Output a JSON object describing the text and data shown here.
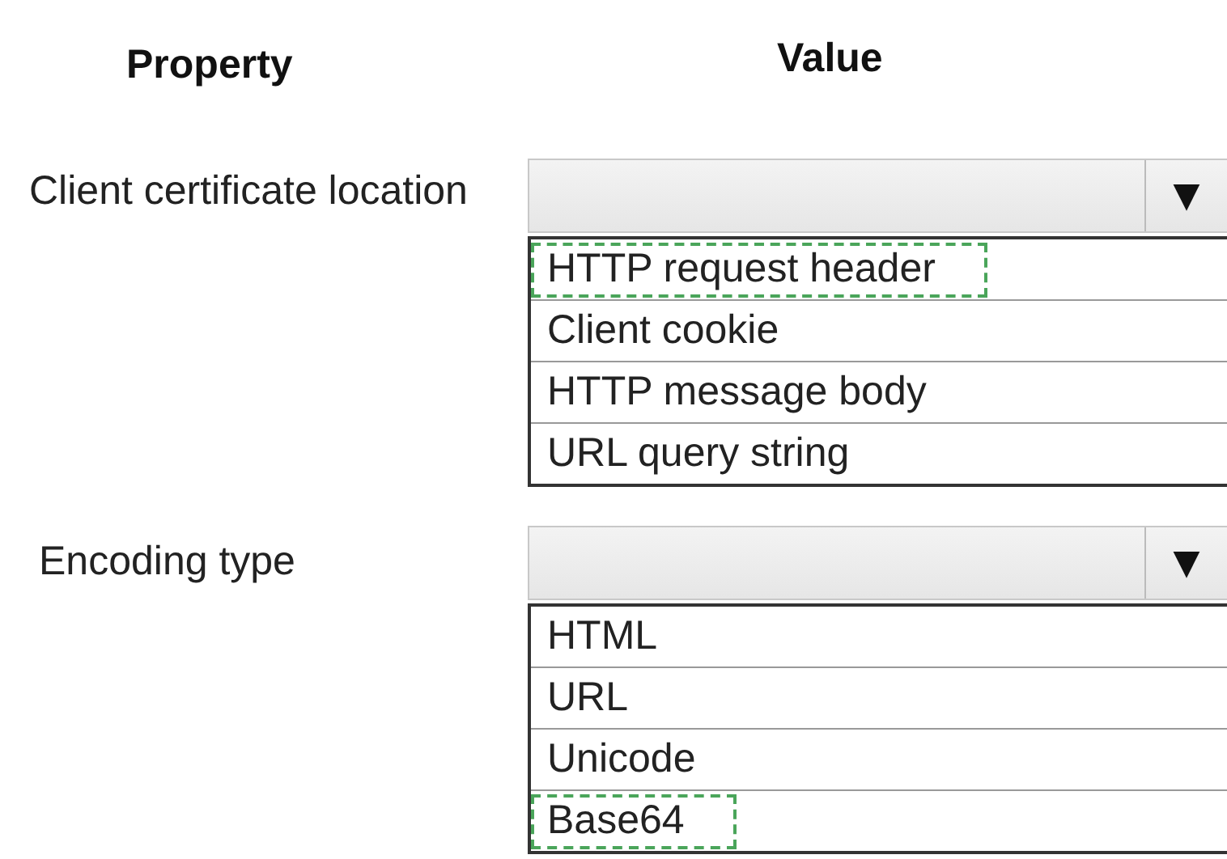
{
  "headers": {
    "property": "Property",
    "value": "Value"
  },
  "rows": [
    {
      "label": "Client certificate location",
      "arrow": "▼",
      "options": [
        {
          "text": "HTTP request header",
          "selected": true
        },
        {
          "text": "Client cookie",
          "selected": false
        },
        {
          "text": "HTTP message body",
          "selected": false
        },
        {
          "text": "URL query string",
          "selected": false
        }
      ]
    },
    {
      "label": "Encoding type",
      "arrow": "▼",
      "options": [
        {
          "text": "HTML",
          "selected": false
        },
        {
          "text": "URL",
          "selected": false
        },
        {
          "text": "Unicode",
          "selected": false
        },
        {
          "text": "Base64",
          "selected": true
        }
      ]
    }
  ]
}
